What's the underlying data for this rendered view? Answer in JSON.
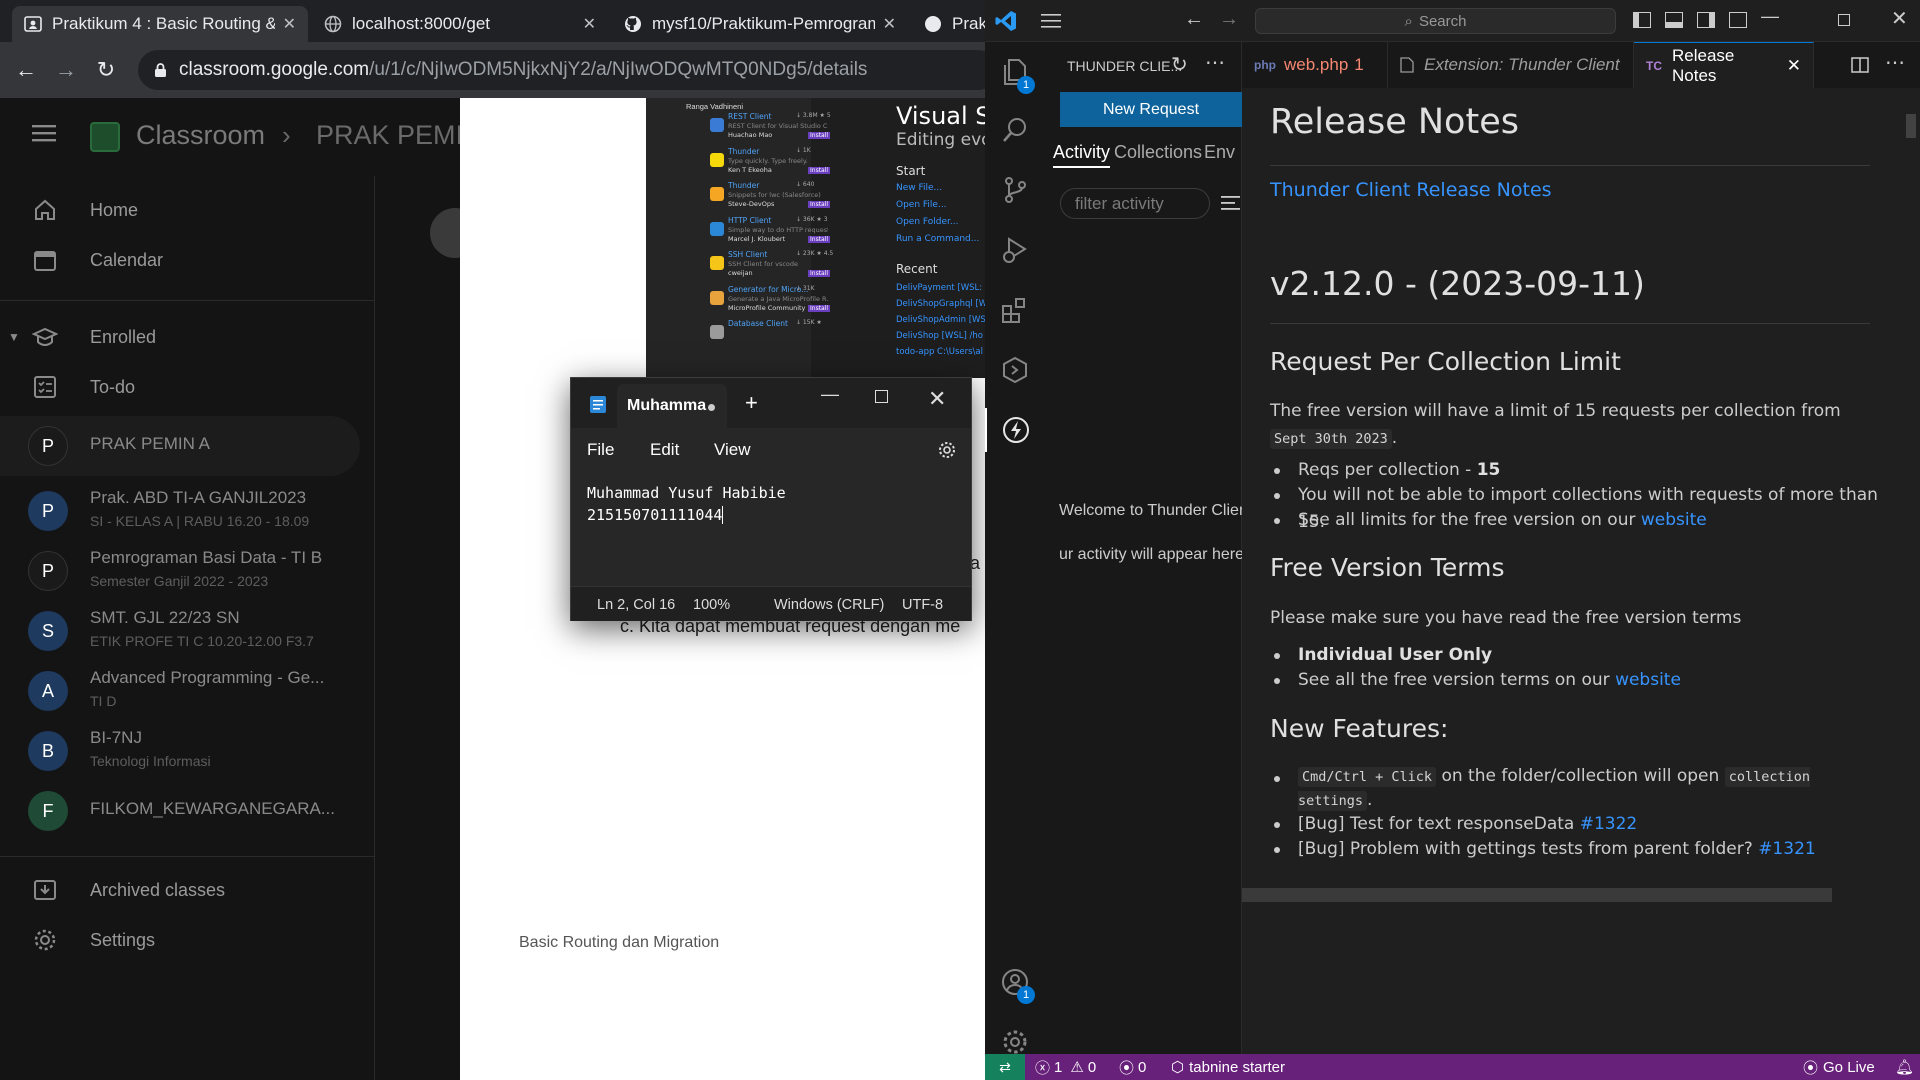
{
  "browser": {
    "tabs": [
      {
        "title": "Praktikum 4 : Basic Routing & M",
        "icon": "classroom-icon"
      },
      {
        "title": "localhost:8000/get",
        "icon": "globe-icon"
      },
      {
        "title": "mysf10/Praktikum-Pemrograma",
        "icon": "github-icon"
      },
      {
        "title": "Prakt",
        "icon": "github-icon"
      }
    ],
    "url_host": "classroom.google.com",
    "url_path": "/u/1/c/NjIwODM5NjkxNjY2/a/NjIwODQwMTQ0NDg5/details"
  },
  "classroom": {
    "app_name": "Classroom",
    "breadcrumb": "PRAK PEMIN",
    "nav": [
      {
        "label": "Home",
        "icon": "home-icon"
      },
      {
        "label": "Calendar",
        "icon": "calendar-icon"
      }
    ],
    "enrolled_label": "Enrolled",
    "todo_label": "To-do",
    "classes": [
      {
        "initial": "P",
        "name": "PRAK PEMIN A",
        "sub": "",
        "color": "#1a1a1a"
      },
      {
        "initial": "P",
        "name": "Prak. ABD TI-A GANJIL2023",
        "sub": "SI - KELAS A | RABU 16.20 - 18.09",
        "color": "#1e3a5f"
      },
      {
        "initial": "P",
        "name": "Pemrograman Basi Data - TI B",
        "sub": "Semester Ganjil 2022 - 2023",
        "color": "#1a1a1a"
      },
      {
        "initial": "S",
        "name": "SMT. GJL 22/23 SN",
        "sub": "ETIK PROFE TI C 10.20-12.00 F3.7",
        "color": "#1e3a5f"
      },
      {
        "initial": "A",
        "name": "Advanced Programming - Ge...",
        "sub": "TI D",
        "color": "#1e3a5f"
      },
      {
        "initial": "B",
        "name": "BI-7NJ",
        "sub": "Teknologi Informasi",
        "color": "#1e3a5f"
      },
      {
        "initial": "F",
        "name": "FILKOM_KEWARGANEGARA...",
        "sub": "",
        "color": "#1f4a36"
      }
    ],
    "archived_label": "Archived classes",
    "settings_label": "Settings"
  },
  "document": {
    "vscode_title": "Visual St",
    "vscode_subtitle": "Editing evol",
    "start_heading": "Start",
    "start_items": [
      "New File...",
      "Open File...",
      "Open Folder...",
      "Run a Command..."
    ],
    "recent_heading": "Recent",
    "recent_items": [
      "DelivPayment [WSL: Ub",
      "DelivShopGraphql [WS",
      "DelivShopAdmin [WSL",
      "DelivShop [WSL] /ho",
      "todo-app   C:\\Users\\al"
    ],
    "extensions": [
      {
        "name": "",
        "desc": "",
        "author": "Ranga Vadhineni",
        "stats": ""
      },
      {
        "name": "REST Client",
        "desc": "REST Client for Visual Studio C...",
        "author": "Huachao Mao",
        "stats": "↓ 3.8M ★ 5"
      },
      {
        "name": "Thunder",
        "desc": "Type quickly. Type freely.",
        "author": "Ken T Ekeoha",
        "stats": "↓ 1K"
      },
      {
        "name": "Thunder",
        "desc": "Snippets for lwc (Salesforce)",
        "author": "Steve-DevOps",
        "stats": "↓ 640"
      },
      {
        "name": "HTTP Client",
        "desc": "Simple way to do HTTP requests",
        "author": "Marcel J. Kloubert",
        "stats": "↓ 36K ★ 3"
      },
      {
        "name": "SSH Client",
        "desc": "SSH Client for vscode",
        "author": "cweijan",
        "stats": "↓ 23K ★ 4.5"
      },
      {
        "name": "Generator for Micro...",
        "desc": "Generate a Java MicroProfile R...",
        "author": "MicroProfile Community",
        "stats": "↓ 31K"
      },
      {
        "name": "Database Client",
        "desc": "",
        "author": "",
        "stats": "↓ 15K ★"
      }
    ],
    "install_label": "Install",
    "partial_a": "a",
    "list_line": "c.  Kita dapat membuat request dengan me",
    "footer": "Basic Routing dan Migration"
  },
  "notepad": {
    "tab_title": "Muhamma",
    "menu": [
      "File",
      "Edit",
      "View"
    ],
    "line1": "Muhammad Yusuf Habibie",
    "line2": "215150701111044",
    "status": {
      "position": "Ln 2, Col 16",
      "zoom": "100%",
      "eol": "Windows (CRLF)",
      "encoding": "UTF-8"
    }
  },
  "vscode": {
    "search_placeholder": "Search",
    "sidebar": {
      "title": "THUNDER CLIE...",
      "new_request": "New Request",
      "tabs": [
        "Activity",
        "Collections",
        "Env"
      ],
      "filter_placeholder": "filter activity",
      "welcome": "Welcome to Thunder Clien",
      "activity_note": "ur activity will appear here"
    },
    "editor_tabs": [
      {
        "label": "web.php",
        "badge": "1"
      },
      {
        "label": "Extension: Thunder Client",
        "badge": ""
      },
      {
        "label": "Release Notes",
        "badge": ""
      }
    ],
    "release": {
      "title": "Release Notes",
      "link": "Thunder Client Release Notes",
      "version": "v2.12.0 - (2023-09-11)",
      "h_limit": "Request Per Collection Limit",
      "p_limit_1": "The free version will have a limit of 15 requests per collection from",
      "p_limit_code": "Sept 30th 2023",
      "p_limit_2": ".",
      "b1_text": "Reqs per collection - ",
      "b1_bold": "15",
      "b2": "You will not be able to import collections with requests of more than 15.",
      "b3_text": "See all limits for the free version on our ",
      "website": "website",
      "h_terms": "Free Version Terms",
      "p_terms": "Please make sure you have read the free version terms",
      "t1": "Individual User Only",
      "t2_text": "See all the free version terms on our ",
      "h_new": "New Features:",
      "f1_code1": "Cmd/Ctrl + Click",
      "f1_text": " on the folder/collection will open ",
      "f1_code2": "collection settings",
      "f1_end": ".",
      "f2_text": "[Bug] Test for text responseData ",
      "f2_link": "#1322",
      "f3_text": "[Bug] Problem with gettings tests from parent folder? ",
      "f3_link": "#1321"
    },
    "status": {
      "errors": "1",
      "warnings": "0",
      "ports": "0",
      "tabnine": "tabnine starter",
      "golive": "Go Live"
    },
    "badges": {
      "explorer": "1",
      "accounts": "1"
    }
  },
  "colors": {
    "vscode_accent": "#0e639c",
    "statusbar": "#68217a",
    "link": "#3794ff"
  }
}
